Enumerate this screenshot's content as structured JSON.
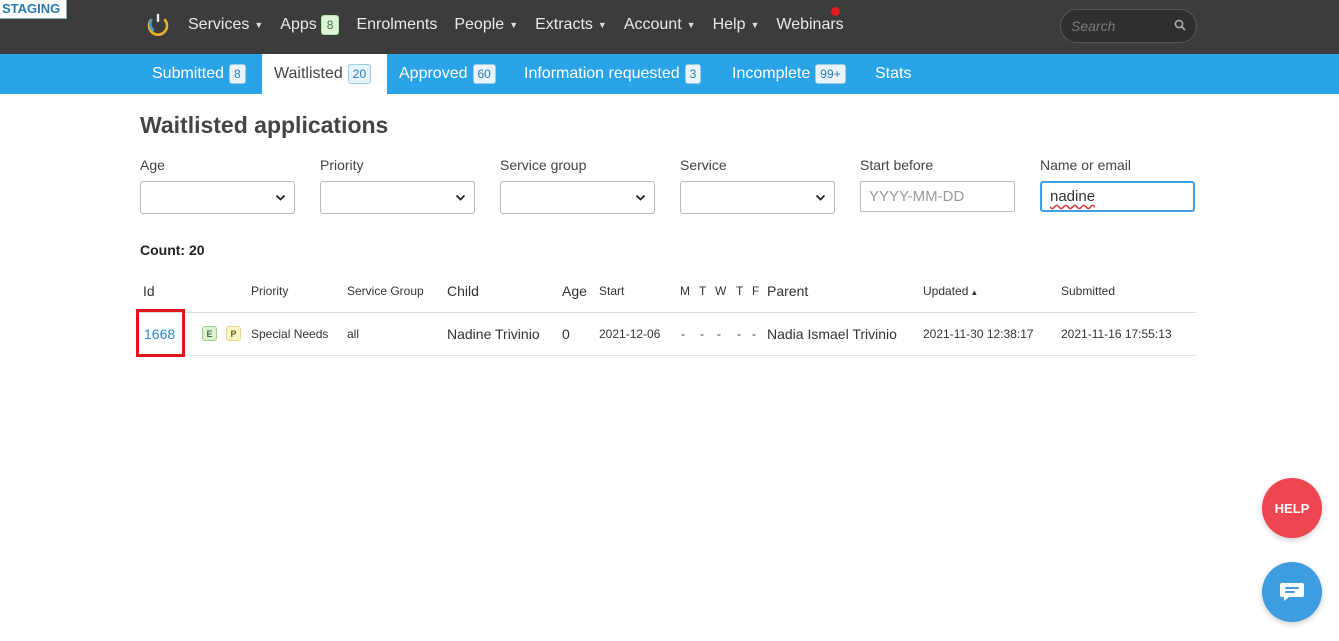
{
  "env_badge": "STAGING",
  "nav": {
    "services": "Services",
    "apps": "Apps",
    "apps_count": "8",
    "enrolments": "Enrolments",
    "people": "People",
    "extracts": "Extracts",
    "account": "Account",
    "help": "Help",
    "webinars": "Webinars",
    "search_placeholder": "Search"
  },
  "tabs": [
    {
      "label": "Submitted",
      "count": "8"
    },
    {
      "label": "Waitlisted",
      "count": "20"
    },
    {
      "label": "Approved",
      "count": "60"
    },
    {
      "label": "Information requested",
      "count": "3"
    },
    {
      "label": "Incomplete",
      "count": "99+"
    },
    {
      "label": "Stats"
    }
  ],
  "page_title": "Waitlisted applications",
  "filters": {
    "age_label": "Age",
    "priority_label": "Priority",
    "service_group_label": "Service group",
    "service_label": "Service",
    "start_before_label": "Start before",
    "start_before_placeholder": "YYYY-MM-DD",
    "name_email_label": "Name or email",
    "name_email_value": "nadine"
  },
  "count_text": "Count: 20",
  "table": {
    "headers": {
      "id": "Id",
      "priority": "Priority",
      "service_group": "Service Group",
      "child": "Child",
      "age": "Age",
      "start": "Start",
      "m": "M",
      "t1": "T",
      "w": "W",
      "t2": "T",
      "f": "F",
      "parent": "Parent",
      "updated": "Updated",
      "sort_indicator": "▲",
      "submitted": "Submitted"
    },
    "rows": [
      {
        "id": "1668",
        "pill_e": "E",
        "pill_p": "P",
        "priority": "Special Needs",
        "service_group": "all",
        "child": "Nadine Trivinio",
        "age": "0",
        "start": "2021-12-06",
        "m": "-",
        "t1": "-",
        "w": "-",
        "t2": "-",
        "f": "-",
        "parent": "Nadia Ismael Trivinio",
        "updated": "2021-11-30 12:38:17",
        "submitted": "2021-11-16 17:55:13"
      }
    ]
  },
  "help_button": "HELP",
  "colors": {
    "topbar": "#3c3c3c",
    "subnav": "#2aa4e8",
    "link": "#2a88cc",
    "highlight": "#e0161e",
    "help": "#ef4550",
    "chat": "#3d9de0"
  }
}
